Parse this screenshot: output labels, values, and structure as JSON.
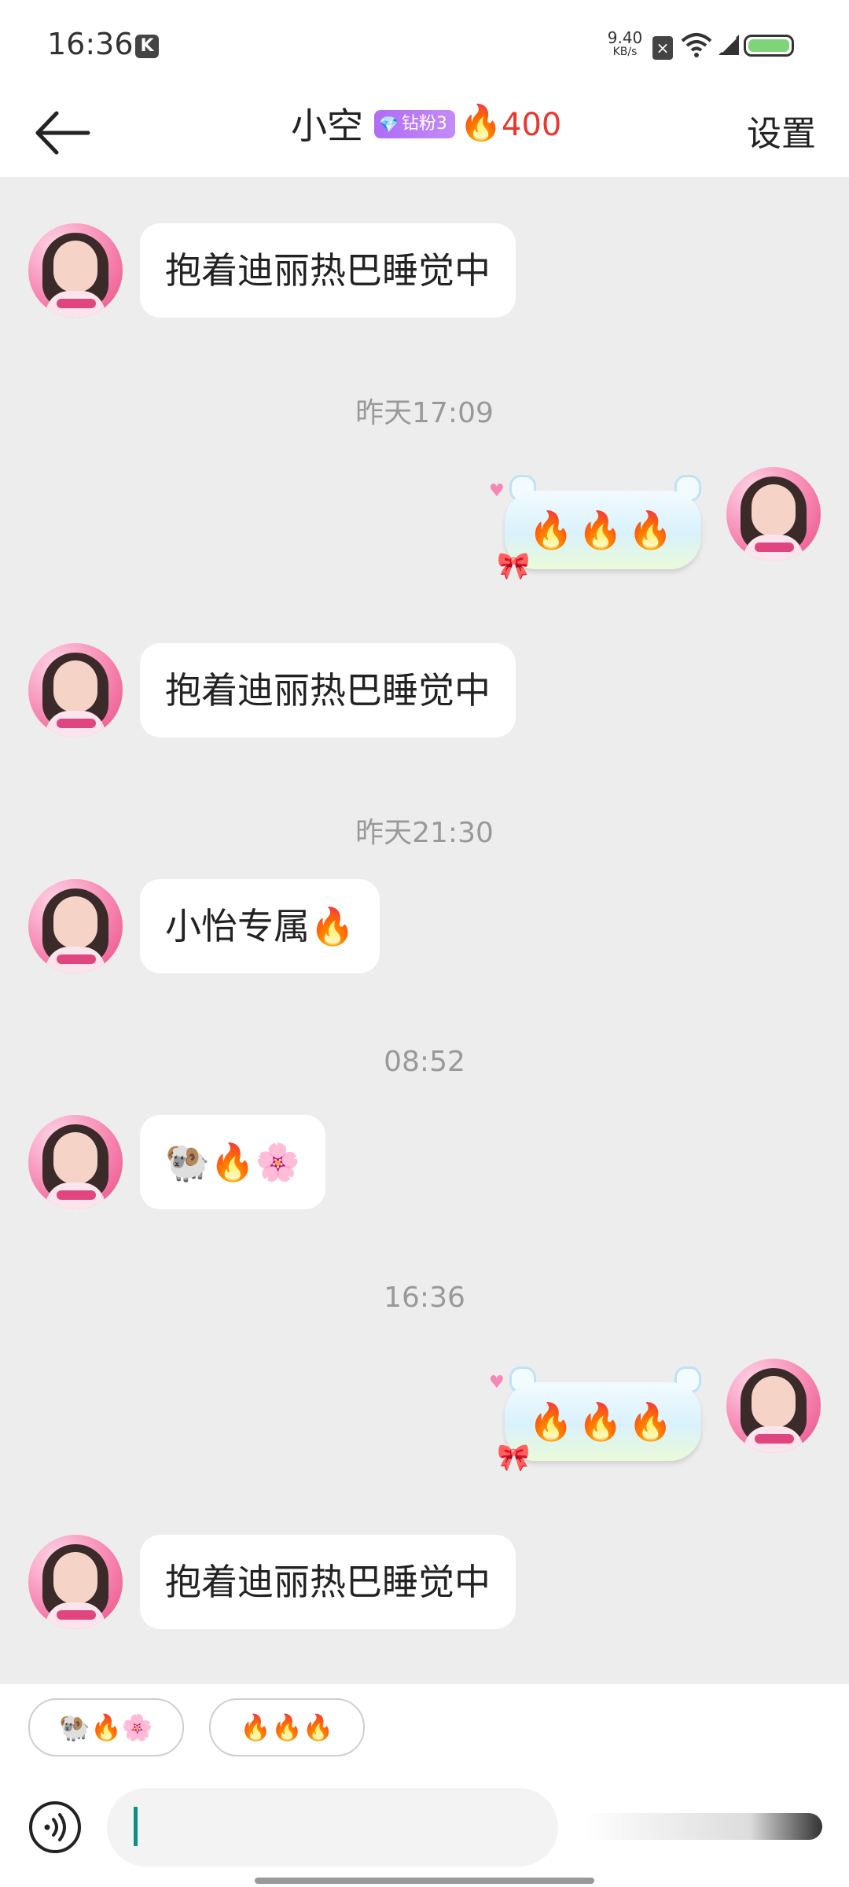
{
  "status_bar": {
    "time": "16:36",
    "app_badge": "K",
    "net_speed_value": "9.40",
    "net_speed_unit": "KB/s",
    "sim_label": "×"
  },
  "header": {
    "title": "小空",
    "fan_badge": "钻粉3",
    "streak_count": "400",
    "settings_label": "设置"
  },
  "messages": [
    {
      "side": "left",
      "text": "抱着迪丽热巴睡觉中"
    },
    {
      "type": "timestamp",
      "text": "昨天17:09"
    },
    {
      "side": "right",
      "text": "🔥🔥🔥"
    },
    {
      "side": "left",
      "text": "抱着迪丽热巴睡觉中"
    },
    {
      "type": "timestamp",
      "text": "昨天21:30"
    },
    {
      "side": "left",
      "text": "小怡专属🔥"
    },
    {
      "type": "timestamp",
      "text": "08:52"
    },
    {
      "side": "left",
      "text": "🐏🔥🌸"
    },
    {
      "type": "timestamp",
      "text": "16:36"
    },
    {
      "side": "right",
      "text": "🔥🔥🔥"
    },
    {
      "side": "left",
      "text": "抱着迪丽热巴睡觉中"
    }
  ],
  "quick_replies": [
    "🐏🔥🌸",
    "🔥🔥🔥"
  ],
  "input": {
    "value": "",
    "placeholder": ""
  },
  "colors": {
    "accent_red": "#e8382f",
    "fan_badge": "#b06cf6",
    "caret": "#0d8f86",
    "chat_bg": "#ededed"
  }
}
